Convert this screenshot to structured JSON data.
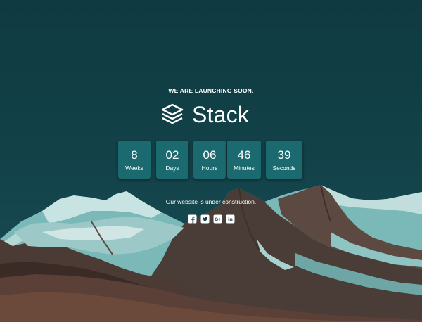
{
  "header": {
    "eyebrow": "WE ARE LAUNCHING SOON.",
    "brand_name": "Stack",
    "brand_icon": "layers-icon"
  },
  "countdown": [
    {
      "value": "8",
      "label": "Weeks"
    },
    {
      "value": "02",
      "label": "Days"
    },
    {
      "value": "06",
      "label": "Hours"
    },
    {
      "value": "46",
      "label": "Minutes"
    },
    {
      "value": "39",
      "label": "Seconds"
    }
  ],
  "footer": {
    "note": "Our website is under construction.",
    "social": [
      {
        "name": "facebook",
        "icon": "facebook-icon"
      },
      {
        "name": "twitter",
        "icon": "twitter-icon"
      },
      {
        "name": "google-plus",
        "icon": "google-plus-icon"
      },
      {
        "name": "linkedin",
        "icon": "linkedin-icon"
      }
    ]
  },
  "colors": {
    "sky": "#0f3a41",
    "tile": "#1b6a70",
    "text": "#ffffff"
  }
}
